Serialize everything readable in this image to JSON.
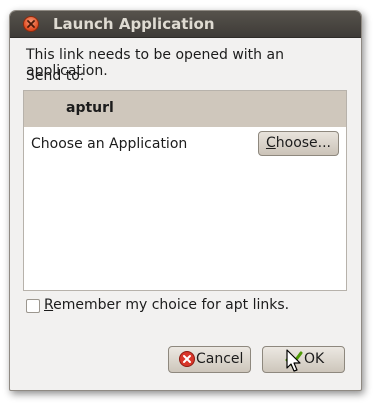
{
  "dialog": {
    "title": "Launch Application",
    "message": "This link needs to be opened with an application.",
    "send_to_label": "Send to:",
    "list": {
      "header_app": "apturl",
      "row_label": "Choose an Application",
      "choose_button": {
        "accel": "C",
        "rest": "hoose..."
      }
    },
    "remember": {
      "accel": "R",
      "rest": "emember my choice for apt links.",
      "checked": false
    },
    "buttons": {
      "cancel": "Cancel",
      "ok": "OK"
    }
  },
  "colors": {
    "titlebar": "#3e3b37",
    "window_bg": "#f2f1f0",
    "header_bg": "#cfc7bc",
    "close_button": "#df4a20"
  }
}
